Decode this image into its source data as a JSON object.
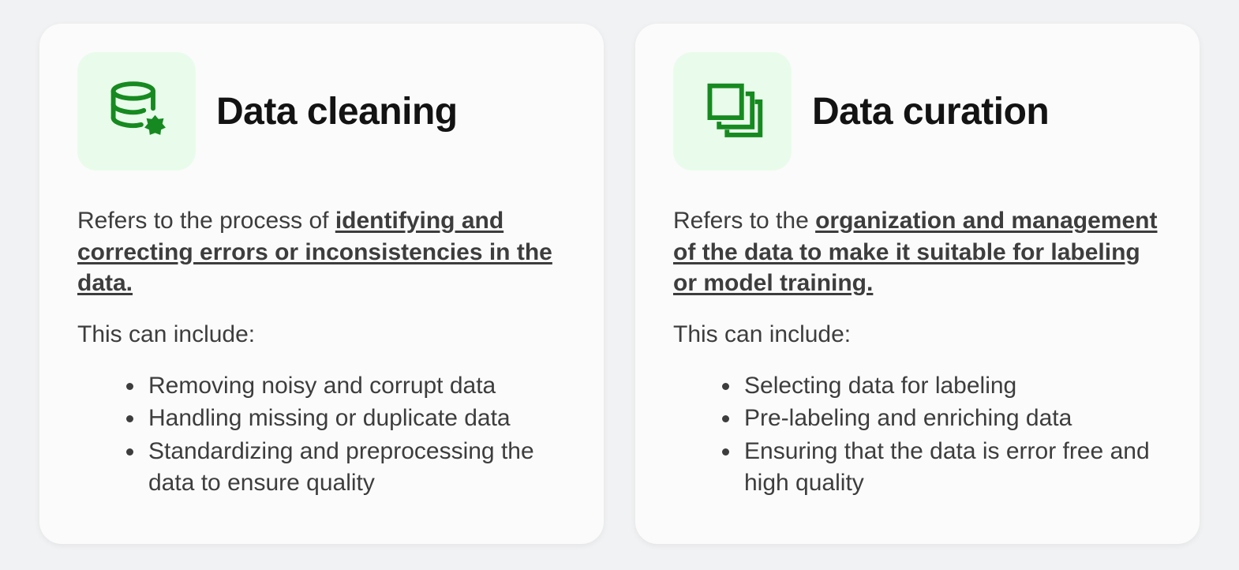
{
  "cards": [
    {
      "id": "data-cleaning",
      "icon": "database-gear-icon",
      "title": "Data cleaning",
      "desc_prefix": "Refers to the process of ",
      "desc_emph": "identifying and correcting errors or inconsistencies in the data.",
      "lead": "This can include:",
      "items": [
        "Removing noisy and corrupt data",
        "Handling missing or duplicate data",
        "Standardizing and preprocessing the data to ensure quality"
      ]
    },
    {
      "id": "data-curation",
      "icon": "layers-stack-icon",
      "title": "Data curation",
      "desc_prefix": "Refers to the ",
      "desc_emph": "organization and management of the data to make it suitable for labeling or model training.",
      "lead": "This can include:",
      "items": [
        "Selecting data for labeling",
        "Pre-labeling and enriching data",
        "Ensuring that the data is error free and high quality"
      ]
    }
  ],
  "colors": {
    "accent": "#168a20",
    "icon_bg": "#e9fceb",
    "page_bg": "#f1f2f3",
    "card_bg": "#fbfbfb"
  }
}
